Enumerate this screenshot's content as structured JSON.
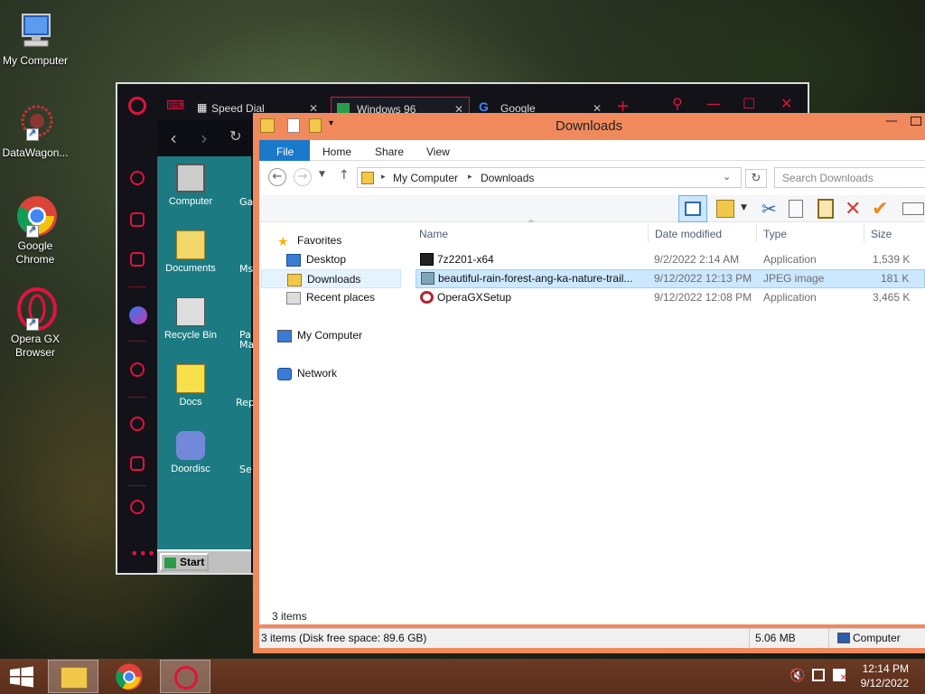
{
  "desktop": {
    "icons": [
      {
        "label": "My Computer"
      },
      {
        "label": "DataWagon..."
      },
      {
        "label": "Google Chrome"
      },
      {
        "label": "Opera GX Browser"
      }
    ]
  },
  "opera": {
    "tabs": [
      {
        "label": "Speed Dial",
        "close": "✕"
      },
      {
        "label": "Windows 96",
        "close": "✕"
      },
      {
        "label": "Google",
        "close": "✕"
      }
    ],
    "new_tab": "+",
    "w96_icons": [
      "Computer",
      "Documents",
      "Recycle Bin",
      "Docs",
      "Doordisc"
    ],
    "w96_icons_partial": [
      "Ga",
      "Ms",
      "Pa Ma",
      "Rep",
      "Se"
    ],
    "start_label": "Start"
  },
  "explorer": {
    "title": "Downloads",
    "ribbon_tabs": [
      "File",
      "Home",
      "Share",
      "View"
    ],
    "breadcrumb": [
      "My Computer",
      "Downloads"
    ],
    "search_placeholder": "Search Downloads",
    "nav": {
      "favorites": "Favorites",
      "desktop": "Desktop",
      "downloads": "Downloads",
      "recent": "Recent places",
      "computer": "My Computer",
      "network": "Network"
    },
    "columns": {
      "name": "Name",
      "date": "Date modified",
      "type": "Type",
      "size": "Size"
    },
    "files": [
      {
        "name": "7z2201-x64",
        "date": "9/2/2022 2:14 AM",
        "type": "Application",
        "size": "1,539 K",
        "icon": "7zip-icon"
      },
      {
        "name": "beautiful-rain-forest-ang-ka-nature-trail...",
        "date": "9/12/2022 12:13 PM",
        "type": "JPEG image",
        "size": "181 K",
        "icon": "image-icon",
        "selected": true
      },
      {
        "name": "OperaGXSetup",
        "date": "9/12/2022 12:08 PM",
        "type": "Application",
        "size": "3,465 K",
        "icon": "opera-gx-icon"
      }
    ],
    "item_count": "3 items",
    "status_left": "3 items (Disk free space: 89.6 GB)",
    "status_size": "5.06 MB",
    "status_location": "Computer"
  },
  "taskbar": {
    "time": "12:14 PM",
    "date": "9/12/2022"
  },
  "colors": {
    "explorer_frame": "#f08a5d",
    "opera_accent": "#e0123e",
    "selection": "#cce8ff",
    "file_tab": "#1979ca"
  }
}
